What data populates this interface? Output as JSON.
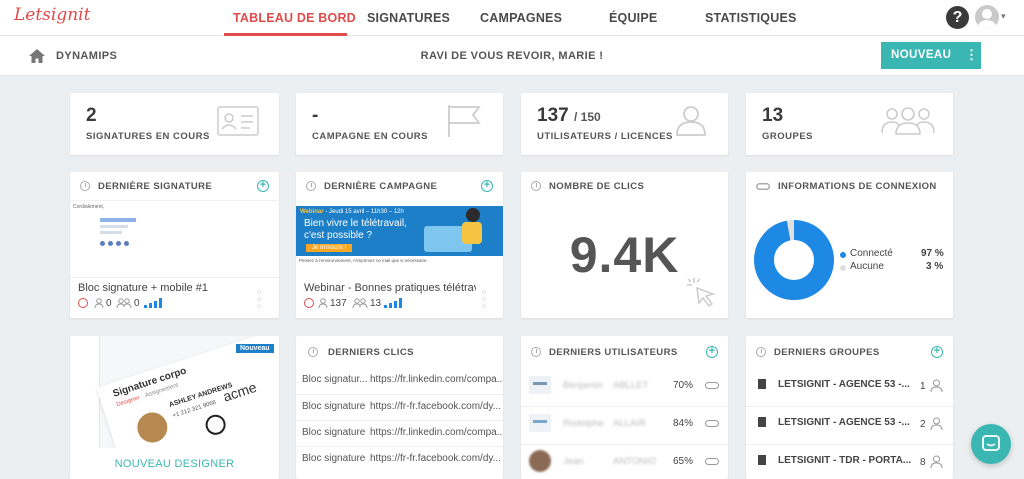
{
  "brand": {
    "logo": "Letsignit",
    "accent": "#e04b4b",
    "teal": "#3ab7b3"
  },
  "nav": {
    "items": [
      "TABLEAU DE BORD",
      "SIGNATURES",
      "CAMPAGNES",
      "ÉQUIPE",
      "STATISTIQUES"
    ],
    "active": "TABLEAU DE BORD",
    "help": "?"
  },
  "bar": {
    "org": "DYNAMIPS",
    "welcome": "RAVI DE VOUS REVOIR, MARIE !",
    "new_label": "NOUVEAU",
    "more": "⋮"
  },
  "stats": [
    {
      "value": "2",
      "suffix": "",
      "label": "SIGNATURES EN COURS",
      "icon": "id-card-icon"
    },
    {
      "value": "-",
      "suffix": "",
      "label": "CAMPAGNE EN COURS",
      "icon": "flag-icon"
    },
    {
      "value": "137",
      "suffix": "/ 150",
      "label": "UTILISATEURS / LICENCES",
      "icon": "user-icon"
    },
    {
      "value": "13",
      "suffix": "",
      "label": "GROUPES",
      "icon": "group-icon"
    }
  ],
  "last_signature": {
    "title": "DERNIÈRE SIGNATURE",
    "preview_text": "Cordialement,",
    "name": "Bloc signature + mobile #1",
    "users": "0",
    "groups": "0"
  },
  "last_campaign": {
    "title": "DERNIÈRE CAMPAGNE",
    "banner_tag": "Webinar",
    "banner_date": "- Jeudi 15 avril – 11h30 – 12h",
    "banner_headline_1": "Bien vivre le télétravail,",
    "banner_headline_2": "c'est possible ?",
    "banner_cta": "Je m'inscris !",
    "banner_footer": "Pensez à l'environnement, n'imprimez ce mail que si nécessaire.",
    "name": "Webinar - Bonnes pratiques télétrav",
    "users": "137",
    "groups": "13"
  },
  "clicks": {
    "title": "NOMBRE DE CLICS",
    "value": "9.4K"
  },
  "connection": {
    "title": "INFORMATIONS DE CONNEXION",
    "legend": [
      {
        "label": "Connecté",
        "value": "97 %",
        "color": "#1e88e5",
        "pct": 97
      },
      {
        "label": "Aucune",
        "value": "3 %",
        "color": "#e0e0e0",
        "pct": 3
      }
    ]
  },
  "designer": {
    "badge": "Nouveau",
    "preview_title": "Signature corpo",
    "tab_designer": "Designer",
    "tab_assignment": "Assignement",
    "person_name": "ASHLEY ANDREWS",
    "person_phone": "+1 212 321 9066",
    "brand_name": "acme",
    "cta": "NOUVEAU DESIGNER"
  },
  "last_clicks": {
    "title": "DERNIERS CLICS",
    "rows": [
      {
        "name": "Bloc signatur...",
        "url": "https://fr.linkedin.com/compa..."
      },
      {
        "name": "Bloc signature",
        "url": "https://fr-fr.facebook.com/dy..."
      },
      {
        "name": "Bloc signature",
        "url": "https://fr.linkedin.com/compa..."
      },
      {
        "name": "Bloc signature",
        "url": "https://fr-fr.facebook.com/dy..."
      }
    ]
  },
  "last_users": {
    "title": "DERNIERS UTILISATEURS",
    "rows": [
      {
        "first": "Benjamin",
        "last": "ABLLET",
        "pct": "70%"
      },
      {
        "first": "Rodolphe",
        "last": "ALLAIR",
        "pct": "84%"
      },
      {
        "first": "Jean",
        "last": "ANTONIO",
        "pct": "65%"
      }
    ]
  },
  "last_groups": {
    "title": "DERNIERS GROUPES",
    "rows": [
      {
        "name": "LETSIGNIT - AGENCE 53 -...",
        "count": "1"
      },
      {
        "name": "LETSIGNIT - AGENCE 53 -...",
        "count": "2"
      },
      {
        "name": "LETSIGNIT - TDR - PORTA...",
        "count": "8"
      }
    ]
  }
}
